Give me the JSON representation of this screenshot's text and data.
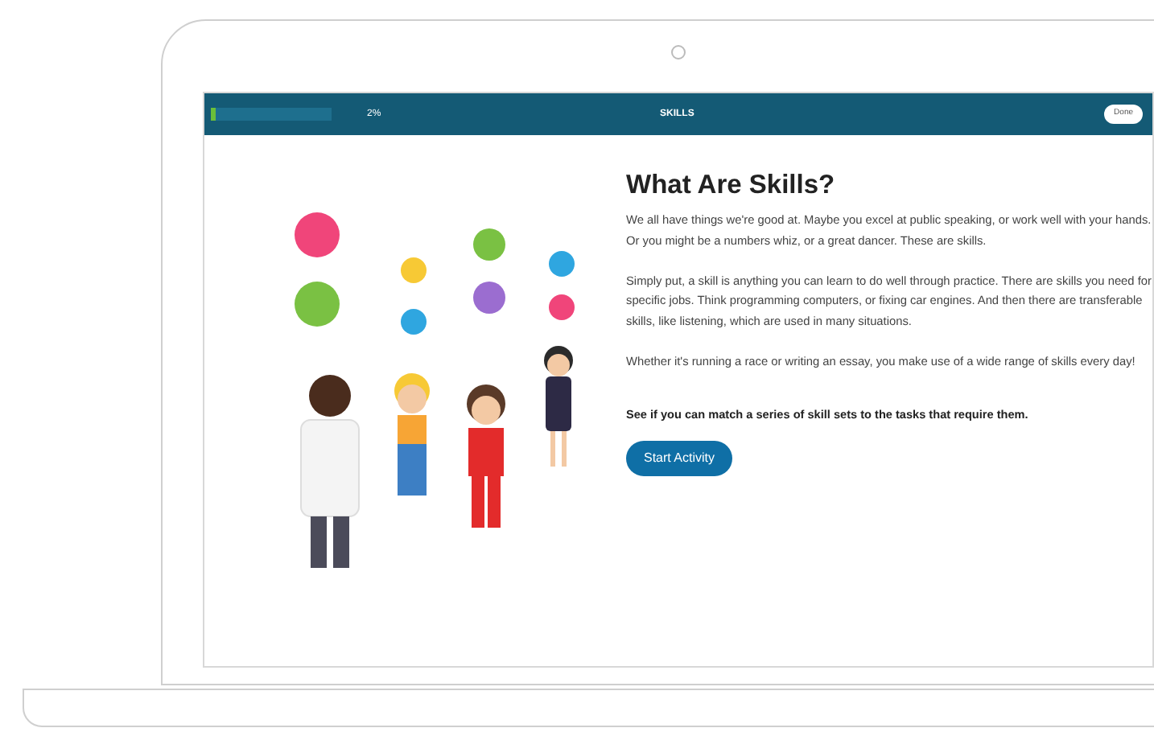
{
  "header": {
    "progress": {
      "level": 0.02
    },
    "percent": "2%",
    "title": "SKILLS",
    "done_button": "Done"
  },
  "content": {
    "heading": "What Are Skills?",
    "paragraphs": [
      "We all have things we're good at. Maybe you excel at public speaking, or work well with your hands. Or you might be a numbers whiz, or a great dancer. These are skills.",
      "Simply put, a skill is anything you can learn to do well through practice. There are skills you need for specific jobs. Think programming computers, or fixing car engines. And then there are transferable skills, like listening, which are used in many situations.",
      "Whether it's running a race or writing an essay, you make use of a wide range of skills every day!"
    ],
    "prompt": "See if you can match a series of skill sets to the tasks that require them.",
    "start_button": "Start Activity"
  }
}
